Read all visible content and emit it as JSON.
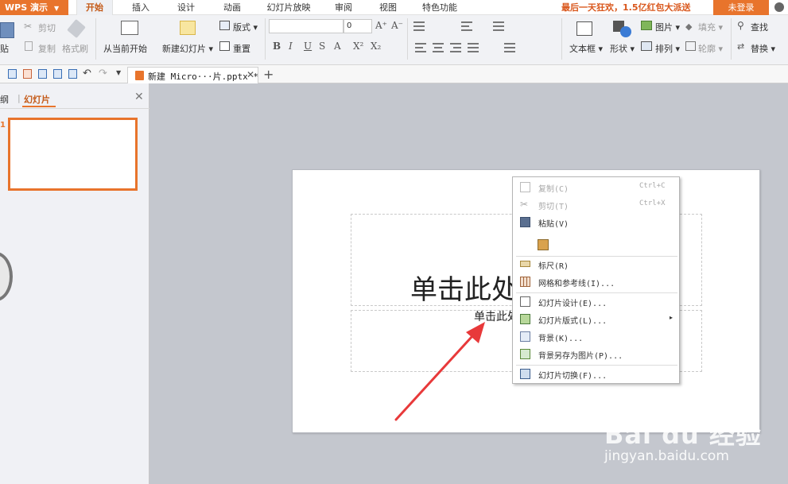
{
  "menubar": {
    "app_menu": "WPS 演示",
    "tabs": [
      "开始",
      "插入",
      "设计",
      "动画",
      "幻灯片放映",
      "审阅",
      "视图",
      "特色功能"
    ],
    "promo": "最后一天狂欢，1.5亿红包大派送",
    "login": "未登录"
  },
  "ribbon": {
    "paste": "贴",
    "cut": "剪切",
    "copy": "复制",
    "format_painter": "格式刷",
    "from_current": "从当前开始",
    "new_slide": "新建幻灯片",
    "layout": "版式",
    "reset": "重置",
    "font_size": "0",
    "text_box": "文本框",
    "shape": "形状",
    "picture": "图片",
    "fill": "填充",
    "arrange": "排列",
    "outline": "轮廓",
    "find": "查找",
    "replace": "替换"
  },
  "doc_tab": {
    "title": "新建 Micro···片.pptx *"
  },
  "panel": {
    "outline_tab": "纲",
    "separator": "|",
    "slides_tab": "幻灯片",
    "thumb_number": "1"
  },
  "slide": {
    "title_placeholder": "单击此处",
    "subtitle_placeholder": "单击此处"
  },
  "context_menu": {
    "items": [
      {
        "label": "复制(C)",
        "shortcut": "Ctrl+C",
        "enabled": false
      },
      {
        "label": "剪切(T)",
        "shortcut": "Ctrl+X",
        "enabled": false
      },
      {
        "label": "粘贴(V)",
        "shortcut": "",
        "enabled": true
      },
      {
        "label": "标尺(R)",
        "shortcut": "",
        "enabled": true
      },
      {
        "label": "网格和参考线(I)...",
        "shortcut": "",
        "enabled": true
      },
      {
        "label": "幻灯片设计(E)...",
        "shortcut": "",
        "enabled": true
      },
      {
        "label": "幻灯片版式(L)...",
        "shortcut": "",
        "enabled": true,
        "submenu": true
      },
      {
        "label": "背景(K)...",
        "shortcut": "",
        "enabled": true
      },
      {
        "label": "背景另存为图片(P)...",
        "shortcut": "",
        "enabled": true
      },
      {
        "label": "幻灯片切换(F)...",
        "shortcut": "",
        "enabled": true
      }
    ]
  },
  "watermark": {
    "brand": "Bai du 经验",
    "url": "jingyan.baidu.com"
  },
  "colors": {
    "accent": "#e8742c",
    "arrow": "#e8393a"
  }
}
